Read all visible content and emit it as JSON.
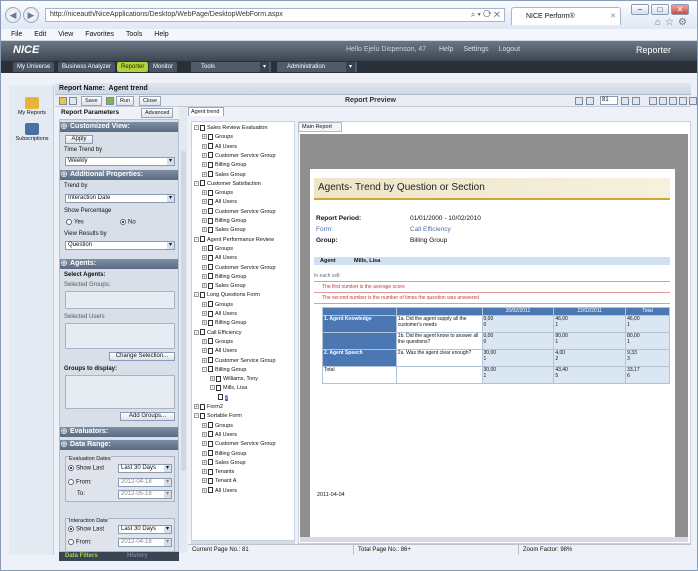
{
  "browser": {
    "url": "http://niceauth/NiceApplications/Desktop/WebPage/DesktopWebForm.aspx",
    "tab_title": "NICE Perform®",
    "menu": [
      "File",
      "Edit",
      "View",
      "Favorites",
      "Tools",
      "Help"
    ]
  },
  "header": {
    "logo": "NICE",
    "user": "Hello Ejelu Dispenson, 47",
    "links": [
      "Help",
      "Settings",
      "Logout"
    ],
    "app_title": "Reporter"
  },
  "modules": [
    "My Universe",
    "Business Analyzer",
    "Reporter",
    "Monitor"
  ],
  "menus": {
    "tools": "Tools",
    "administration": "Administration"
  },
  "leftnav": [
    {
      "label": "My Reports",
      "icon": "my-reports-icon"
    },
    {
      "label": "Subscriptions",
      "icon": "subscriptions-icon"
    }
  ],
  "report": {
    "name_label": "Report Name:",
    "name": "Agent trend"
  },
  "toolbar": {
    "save": "Save",
    "run": "Run",
    "close": "Close",
    "preview_title": "Report Preview",
    "page": "81",
    "params_label": "Report Parameters",
    "advanced": "Advanced",
    "tree_tab": "Agent trend"
  },
  "params": {
    "customized": "Customized View:",
    "apply": "Apply",
    "time_trend_label": "Time Trend by",
    "time_trend": "Weekly",
    "additional": "Additional Properties:",
    "trend_by_label": "Trend by",
    "trend_by": "Interaction Date",
    "show_pct_label": "Show Percentage",
    "yes": "Yes",
    "no": "No",
    "view_results_label": "View Results by",
    "view_results": "Question",
    "agents": "Agents:",
    "select_agents": "Select Agents:",
    "selected_groups": "Selected Groups:",
    "selected_users": "Selected Users",
    "change_selection": "Change Selection...",
    "groups_display": "Groups to display:",
    "add_groups": "Add Groups...",
    "evaluators": "Evaluators:",
    "data_range": "Data Range:",
    "eval_dates": "Evaluation Dates",
    "show_last": "Show Last",
    "last_30": "Last 30 Days",
    "from": "From:",
    "to": "To:",
    "from_date": "2012-04-18",
    "to_date": "2012-05-18",
    "interaction_date": "Interaction Date",
    "tab_filters": "Data Filters",
    "tab_history": "History"
  },
  "tree": [
    {
      "label": "Sales Review Evaluation",
      "level": 0,
      "pm": "-"
    },
    {
      "label": "Groups",
      "level": 1,
      "pm": "+"
    },
    {
      "label": "All Users",
      "level": 1,
      "pm": "+"
    },
    {
      "label": "Customer Service Group",
      "level": 1,
      "pm": "+"
    },
    {
      "label": "Billing Group",
      "level": 1,
      "pm": "+"
    },
    {
      "label": "Sales Group",
      "level": 1,
      "pm": "+"
    },
    {
      "label": "Customer Satisfaction",
      "level": 0,
      "pm": "-"
    },
    {
      "label": "Groups",
      "level": 1,
      "pm": "+"
    },
    {
      "label": "All Users",
      "level": 1,
      "pm": "+"
    },
    {
      "label": "Customer Service Group",
      "level": 1,
      "pm": "+"
    },
    {
      "label": "Billing Group",
      "level": 1,
      "pm": "+"
    },
    {
      "label": "Sales Group",
      "level": 1,
      "pm": "+"
    },
    {
      "label": "Agent Performance Review",
      "level": 0,
      "pm": "-"
    },
    {
      "label": "Groups",
      "level": 1,
      "pm": "+"
    },
    {
      "label": "All Users",
      "level": 1,
      "pm": "+"
    },
    {
      "label": "Customer Service Group",
      "level": 1,
      "pm": "+"
    },
    {
      "label": "Billing Group",
      "level": 1,
      "pm": "+"
    },
    {
      "label": "Sales Group",
      "level": 1,
      "pm": "+"
    },
    {
      "label": "Long Questions Form",
      "level": 0,
      "pm": "-"
    },
    {
      "label": "Groups",
      "level": 1,
      "pm": "+"
    },
    {
      "label": "All Users",
      "level": 1,
      "pm": "+"
    },
    {
      "label": "Billing Group",
      "level": 1,
      "pm": "+"
    },
    {
      "label": "Call Efficiency",
      "level": 0,
      "pm": "-"
    },
    {
      "label": "Groups",
      "level": 1,
      "pm": "+"
    },
    {
      "label": "All Users",
      "level": 1,
      "pm": "+"
    },
    {
      "label": "Customer Service Group",
      "level": 1,
      "pm": "+"
    },
    {
      "label": "Billing Group",
      "level": 1,
      "pm": "-"
    },
    {
      "label": "Williams, Tony",
      "level": 2,
      "pm": "+"
    },
    {
      "label": "Mills, Lisa",
      "level": 2,
      "pm": "-"
    },
    {
      "label": "2",
      "level": 3,
      "pm": ""
    },
    {
      "label": "Form2",
      "level": 0,
      "pm": "+"
    },
    {
      "label": "Sortable Form",
      "level": 0,
      "pm": "-"
    },
    {
      "label": "Groups",
      "level": 1,
      "pm": "+"
    },
    {
      "label": "All Users",
      "level": 1,
      "pm": "+"
    },
    {
      "label": "Customer Service Group",
      "level": 1,
      "pm": "+"
    },
    {
      "label": "Billing Group",
      "level": 1,
      "pm": "+"
    },
    {
      "label": "Sales Group",
      "level": 1,
      "pm": "+"
    },
    {
      "label": "Tenants",
      "level": 1,
      "pm": "+"
    },
    {
      "label": "Tenant A",
      "level": 1,
      "pm": "+"
    },
    {
      "label": "All Users",
      "level": 1,
      "pm": "+"
    }
  ],
  "preview": {
    "tab": "Main Report",
    "title": "Agents- Trend by Question or Section",
    "period_label": "Report Period:",
    "period": "01/01/2000 - 10/02/2010",
    "form_label": "Form:",
    "form": "Call Efficiency",
    "group_label": "Group:",
    "group": "Billing Group",
    "agent_label": "Agent",
    "agent": "Mills, Lisa",
    "note_intro": "In each cell:",
    "note1": "The first number is the average score",
    "note2": "The second number is the number of times the question was answered",
    "cols": [
      "20/02/2011",
      "22/02/2011",
      "Total"
    ],
    "rows": [
      {
        "agent": "1. Agent Knowledge",
        "q": "1a. Did the agent supply all the customer's needs",
        "vals": [
          "0,00",
          "46,00",
          "46,00"
        ],
        "counts": [
          "0",
          "1",
          "1"
        ]
      },
      {
        "agent": "",
        "q": "1b. Did the agent know to answer all the questions?",
        "vals": [
          "0,00",
          "80,00",
          "80,00"
        ],
        "counts": [
          "0",
          "1",
          "1"
        ]
      },
      {
        "agent": "2. Agent Speech",
        "q": "2a. Was the agent clear enough?",
        "vals": [
          "30,00",
          "4,00",
          "9,33"
        ],
        "counts": [
          "1",
          "2",
          "3"
        ]
      },
      {
        "agent": "Total",
        "q": "",
        "vals": [
          "30,00",
          "43,40",
          "33,17"
        ],
        "counts": [
          "1",
          "5",
          "6"
        ]
      }
    ],
    "date": "2011-04-04"
  },
  "status": {
    "current": "Current Page No.: 81",
    "total": "Total Page No.: 86+",
    "zoom": "Zoom Factor: 98%"
  }
}
